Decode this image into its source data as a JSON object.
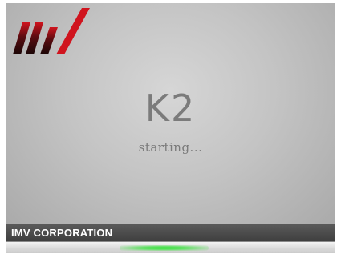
{
  "splash": {
    "product_name": "K2",
    "status_text": "starting...",
    "company_name": "IMV CORPORATION",
    "logo_icon": "imv-logo-icon",
    "progress": {
      "type": "indeterminate-marquee",
      "indicator_position": 0.48,
      "indicator_width": 0.27,
      "color": "#3ad83f"
    }
  },
  "colors": {
    "background": "#c4c4c4",
    "text": "#7b7b7b",
    "footer": "#4a4a4a",
    "logo_red": "#c8141e",
    "logo_dark": "#2a0a0a"
  }
}
